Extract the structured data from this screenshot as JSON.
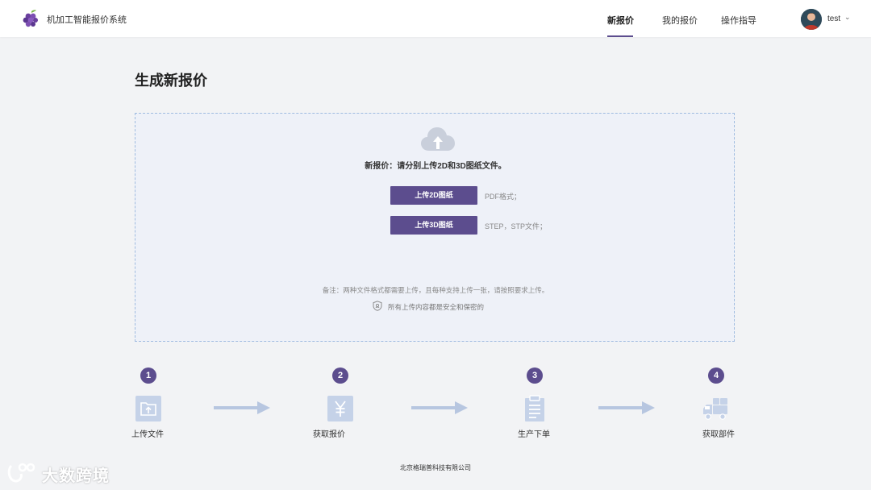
{
  "app": {
    "title": "机加工智能报价系统"
  },
  "nav": {
    "items": [
      {
        "label": "新报价",
        "active": true
      },
      {
        "label": "我的报价",
        "active": false
      },
      {
        "label": "操作指导",
        "active": false
      }
    ]
  },
  "user": {
    "name": "test"
  },
  "page": {
    "title": "生成新报价"
  },
  "upload": {
    "instruction": "新报价：请分别上传2D和3D图纸文件。",
    "btn_2d": "上传2D图纸",
    "hint_2d": "PDF格式；",
    "btn_3d": "上传3D图纸",
    "hint_3d": "STEP，STP文件；",
    "note": "备注：两种文件格式都需要上传，且每种支持上传一张，请按照要求上传。",
    "secure": "所有上传内容都是安全和保密的"
  },
  "steps": [
    {
      "number": "1",
      "label": "上传文件",
      "icon": "folder-upload-icon"
    },
    {
      "number": "2",
      "label": "获取报价",
      "icon": "yen-icon"
    },
    {
      "number": "3",
      "label": "生产下单",
      "icon": "clipboard-icon"
    },
    {
      "number": "4",
      "label": "获取部件",
      "icon": "delivery-truck-icon"
    }
  ],
  "footer": {
    "company": "北京格瑞普科技有限公司"
  },
  "watermark": {
    "text": "大数跨境"
  },
  "colors": {
    "accent": "#5c4d8e",
    "page_bg": "#f2f3f5",
    "upload_bg": "#eef1f8",
    "dashed_border": "#9fbbe0",
    "icon_light": "#b7c6e0"
  }
}
